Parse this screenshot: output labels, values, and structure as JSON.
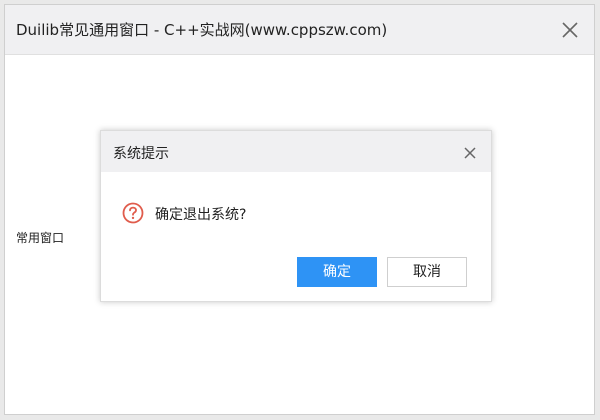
{
  "window": {
    "title": "Duilib常见通用窗口 - C++实战网(www.cppszw.com)",
    "content_label": "常用窗口",
    "close_icon": "close-icon"
  },
  "dialog": {
    "title": "系统提示",
    "message": "确定退出系统?",
    "icon": "question-icon",
    "icon_color": "#e05c4c",
    "ok_label": "确定",
    "cancel_label": "取消",
    "accent_color": "#2e93f5"
  }
}
